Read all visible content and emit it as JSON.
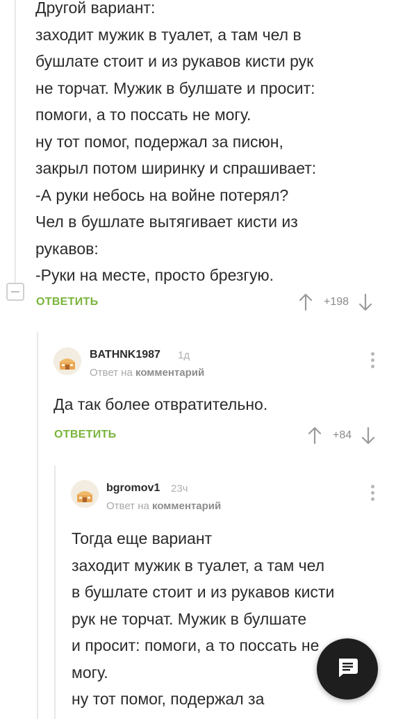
{
  "comments": [
    {
      "text": "Другой вариант:\nзаходит мужик в туалет, а там чел в\nбушлате стоит и из рукавов кисти рук\nне торчат. Мужик в булшате и просит:\nпомоги, а то поссать не могу.\nну тот помог, подержал за писюн,\nзакрыл потом ширинку и спрашивает:\n-А руки небось на войне потерял?\nЧел в бушлате вытягивает кисти из\nрукавов:\n-Руки на месте, просто брезгую.",
      "reply_label": "ОТВЕТИТЬ",
      "score": "+198"
    },
    {
      "username": "BATHNK1987",
      "time": "1д",
      "reply_to_prefix": "Ответ на",
      "reply_to_target": "комментарий",
      "text": "Да так более отвратительно.",
      "reply_label": "ОТВЕТИТЬ",
      "score": "+84"
    },
    {
      "username": "bgromov1",
      "time": "23ч",
      "reply_to_prefix": "Ответ на",
      "reply_to_target": "комментарий",
      "text": "Тогда еще вариант\nзаходит мужик в туалет, а там чел\nв бушлате стоит и из рукавов кисти\nрук не торчат. Мужик в булшате\nи просит: помоги, а то поссать не\nмогу.\nну тот помог, подержал за\nписюн, закрыл потом ширинку и"
    }
  ],
  "icons": {
    "upvote": "arrow-up-icon",
    "downvote": "arrow-down-icon",
    "menu": "kebab-menu-icon",
    "fab": "comments-icon"
  },
  "colors": {
    "reply_green": "#79b43b",
    "fab_bg": "#1e1e1e"
  }
}
